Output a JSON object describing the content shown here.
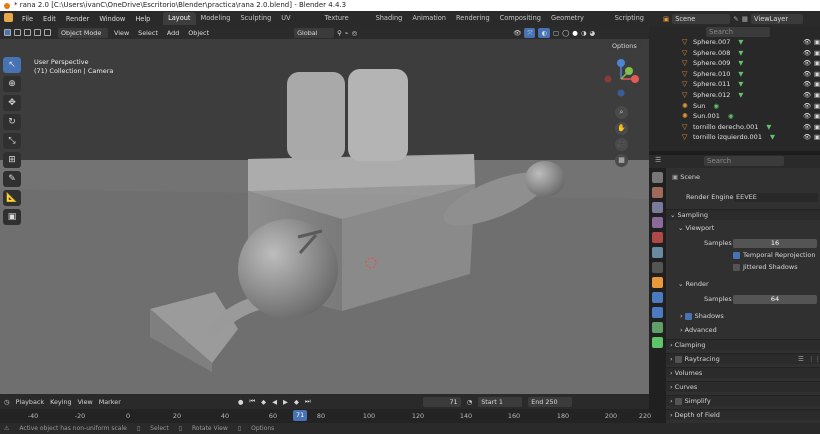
{
  "titlebar": {
    "title": "* rana 2.0 [C:\\Users\\ivanC\\OneDrive\\Escritorio\\Blender\\practica\\rana 2.0.blend] - Blender 4.4.3"
  },
  "menu": [
    "File",
    "Edit",
    "Render",
    "Window",
    "Help"
  ],
  "workspaces": [
    "Layout",
    "Modeling",
    "Sculpting",
    "UV Editing",
    "Texture Paint",
    "Shading",
    "Animation",
    "Rendering",
    "Compositing",
    "Geometry Nodes",
    "Scripting"
  ],
  "scene_selector": {
    "label": "Scene",
    "viewlayer": "ViewLayer"
  },
  "viewport_header": {
    "mode": "Object Mode",
    "view": "View",
    "select": "Select",
    "add": "Add",
    "object": "Object",
    "orientation": "Global",
    "options": "Options"
  },
  "viewport": {
    "perspective": "User Perspective",
    "collection": "(71) Collection | Camera"
  },
  "outliner": {
    "search_placeholder": "Search",
    "items": [
      {
        "name": "Sphere.007",
        "type": "mesh"
      },
      {
        "name": "Sphere.008",
        "type": "mesh"
      },
      {
        "name": "Sphere.009",
        "type": "mesh"
      },
      {
        "name": "Sphere.010",
        "type": "mesh"
      },
      {
        "name": "Sphere.011",
        "type": "mesh"
      },
      {
        "name": "Sphere.012",
        "type": "mesh"
      },
      {
        "name": "Sun",
        "type": "light"
      },
      {
        "name": "Sun.001",
        "type": "light"
      },
      {
        "name": "tornillo derecho.001",
        "type": "mesh"
      },
      {
        "name": "tornillo izquierdo.001",
        "type": "mesh"
      }
    ]
  },
  "properties": {
    "search_placeholder": "Search",
    "scene": "Scene",
    "render_engine_label": "Render Engine",
    "render_engine": "EEVEE",
    "sampling": "Sampling",
    "viewport": "Viewport",
    "samples_label": "Samples",
    "viewport_samples": "16",
    "temporal_reprojection": "Temporal Reprojection",
    "jittered_shadows": "Jittered Shadows",
    "render": "Render",
    "render_samples": "64",
    "shadows": "Shadows",
    "advanced": "Advanced",
    "clamping": "Clamping",
    "raytracing": "Raytracing",
    "volumes": "Volumes",
    "curves": "Curves",
    "simplify": "Simplify",
    "depth_of_field": "Depth of Field"
  },
  "timeline": {
    "playback": "Playback",
    "keying": "Keying",
    "view": "View",
    "marker": "Marker",
    "current_frame": "71",
    "start_label": "Start",
    "start": "1",
    "end_label": "End",
    "end": "250",
    "ticks": [
      "-40",
      "-20",
      "0",
      "20",
      "40",
      "60",
      "80",
      "100",
      "120",
      "140",
      "160",
      "180",
      "200",
      "220"
    ]
  },
  "statusbar": {
    "message": "Active object has non-uniform scale",
    "select": "Select",
    "rotate": "Rotate View",
    "options": "Options"
  },
  "colors": {
    "accent": "#4772b3",
    "orange": "#e8983a",
    "green": "#5fc36a"
  }
}
